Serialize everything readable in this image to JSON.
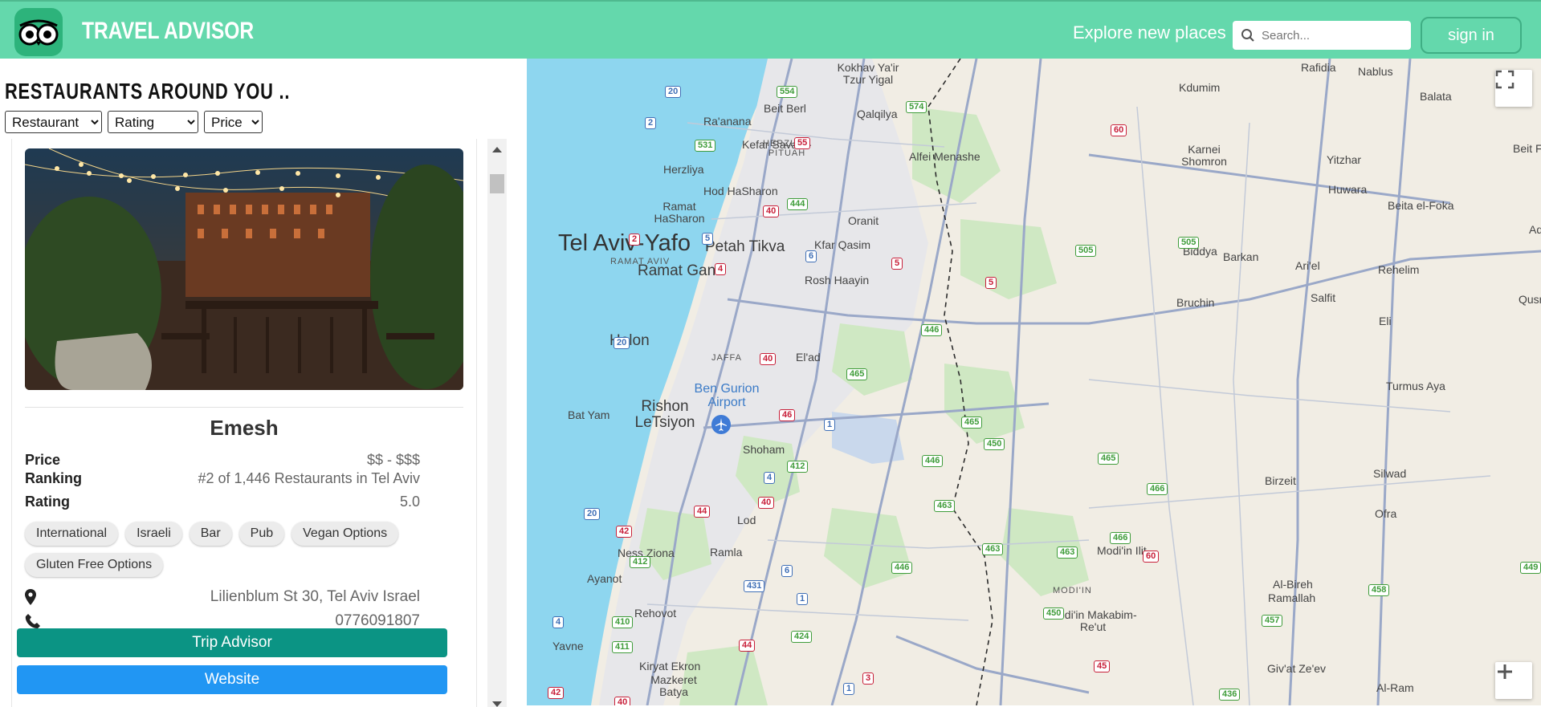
{
  "header": {
    "brand": "TRAVEL ADVISOR",
    "explore_label": "Explore new places",
    "search_placeholder": "Search...",
    "signin_label": "sign in",
    "bg_color": "#64d8ac"
  },
  "panel": {
    "title": "RESTAURANTS AROUND YOU ..",
    "filters": {
      "type": "Restaurant",
      "rating": "Rating",
      "price": "Price"
    }
  },
  "card": {
    "name": "Emesh",
    "rows": [
      {
        "label": "Price",
        "value": "$$ - $$$"
      },
      {
        "label": "Ranking",
        "value": "#2 of 1,446 Restaurants in Tel Aviv"
      },
      {
        "label": "Rating",
        "value": "5.0"
      }
    ],
    "tags": [
      "International",
      "Israeli",
      "Bar",
      "Pub",
      "Vegan Options",
      "Gluten Free Options"
    ],
    "address": "Lilienblum St 30, Tel Aviv Israel",
    "phone": "0776091807",
    "trip_advisor_label": "Trip Advisor",
    "website_label": "Website",
    "trip_color": "#0b9484",
    "website_color": "#2196f3"
  },
  "map": {
    "cities_big": [
      "Tel Aviv-Yafo"
    ],
    "cities_med": [
      "Petah Tikva",
      "Ramat Gan",
      "Holon",
      "Rishon LeTsiyon"
    ],
    "cities_small": [
      "Kokhav Ya'ir Tzur Yigal",
      "Beit Berl",
      "Qalqilya",
      "Ra'anana",
      "Kefar Sava",
      "Alfei Menashe",
      "Herzliya",
      "Hod HaSharon",
      "Ramat HaSharon",
      "Oranit",
      "Kfar Qasim",
      "Rosh Haayin",
      "El'ad",
      "Bat Yam",
      "Shoham",
      "Lod",
      "Ness Ziona",
      "Ramla",
      "Ayanot",
      "Rehovot",
      "Yavne",
      "Kiryat Ekron",
      "Mazkeret Batya",
      "Modi'in Ilit",
      "Modi'in Makabim-Re'ut",
      "Rafidia",
      "Nablus",
      "Kdumim",
      "Balata",
      "Karnei Shomron",
      "Yitzhar",
      "Beit Fu",
      "Huwara",
      "Beita el-Foka",
      "Aq",
      "Biddya",
      "Barkan",
      "Ari'el",
      "Rehelim",
      "Salfit",
      "Qusra",
      "Bruchin",
      "Eli",
      "Turmus Aya",
      "Birzeit",
      "Silwad",
      "Ofra",
      "Al-Bireh",
      "Ramallah",
      "Giv'at Ze'ev",
      "Al-Ram"
    ],
    "cities_caps": [
      "HERZLIYA PITUAH",
      "RAMAT AVIV",
      "JAFFA",
      "MODI'IN"
    ],
    "airport": "Ben Gurion Airport",
    "shields": [
      "20",
      "2",
      "531",
      "2",
      "4",
      "5",
      "6",
      "20",
      "40",
      "46",
      "1",
      "412",
      "4",
      "44",
      "40",
      "42",
      "412",
      "20",
      "6",
      "431",
      "1",
      "410",
      "4",
      "411",
      "44",
      "424",
      "40",
      "3",
      "1",
      "554",
      "574",
      "55",
      "40",
      "444",
      "5",
      "5",
      "446",
      "465",
      "465",
      "446",
      "450",
      "465",
      "466",
      "466",
      "463",
      "463",
      "446",
      "463",
      "450",
      "436",
      "457",
      "458",
      "60",
      "505",
      "505",
      "60",
      "45",
      "449",
      "40",
      "42"
    ]
  }
}
